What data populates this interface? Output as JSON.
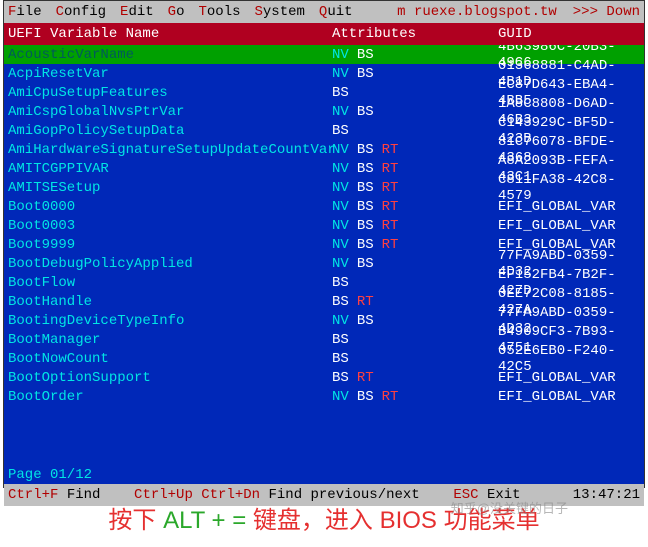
{
  "menubar": {
    "items": [
      {
        "hotkey": "F",
        "rest": "ile"
      },
      {
        "hotkey": "C",
        "rest": "onfig"
      },
      {
        "hotkey": "E",
        "rest": "dit"
      },
      {
        "hotkey": "G",
        "rest": "o"
      },
      {
        "hotkey": "T",
        "rest": "ools"
      },
      {
        "hotkey": "S",
        "rest": "ystem"
      },
      {
        "hotkey": "Q",
        "rest": "uit"
      }
    ],
    "right1": "m ruexe.blogspot.tw",
    "right2": ">>> Down"
  },
  "header": {
    "col1": "UEFI Variable Name",
    "col2": "Attributes",
    "col3": "GUID"
  },
  "rows": [
    {
      "name": "AcousticVarName",
      "attrs": [
        "NV",
        "BS"
      ],
      "guid": "4B63986C-20B3-49C6",
      "selected": true
    },
    {
      "name": "AcpiResetVar",
      "attrs": [
        "NV",
        "BS"
      ],
      "guid": "01368881-C4AD-4B1D"
    },
    {
      "name": "AmiCpuSetupFeatures",
      "attrs": [
        "BS"
      ],
      "guid": "EC87D643-EBA4-4BB5"
    },
    {
      "name": "AmiCspGlobalNvsPtrVar",
      "attrs": [
        "NV",
        "BS"
      ],
      "guid": "1A8C8808-D6AD-46B3"
    },
    {
      "name": "AmiGopPolicySetupData",
      "attrs": [
        "BS"
      ],
      "guid": "C143929C-BF5D-423B"
    },
    {
      "name": "AmiHardwareSignatureSetupUpdateCountVar",
      "attrs": [
        "NV",
        "BS",
        "RT"
      ],
      "guid": "81C76078-BFDE-4368"
    },
    {
      "name": "AMITCGPPIVAR",
      "attrs": [
        "NV",
        "BS",
        "RT"
      ],
      "guid": "A8A2093B-FEFA-43C1"
    },
    {
      "name": "AMITSESetup",
      "attrs": [
        "NV",
        "BS",
        "RT"
      ],
      "guid": "C811FA38-42C8-4579"
    },
    {
      "name": "Boot0000",
      "attrs": [
        "NV",
        "BS",
        "RT"
      ],
      "guid": "EFI_GLOBAL_VAR"
    },
    {
      "name": "Boot0003",
      "attrs": [
        "NV",
        "BS",
        "RT"
      ],
      "guid": "EFI_GLOBAL_VAR"
    },
    {
      "name": "Boot9999",
      "attrs": [
        "NV",
        "BS",
        "RT"
      ],
      "guid": "EFI_GLOBAL_VAR"
    },
    {
      "name": "BootDebugPolicyApplied",
      "attrs": [
        "NV",
        "BS"
      ],
      "guid": "77FA9ABD-0359-4D32"
    },
    {
      "name": "BootFlow",
      "attrs": [
        "BS"
      ],
      "guid": "EF152FB4-7B2F-427D"
    },
    {
      "name": "BootHandle",
      "attrs": [
        "BS",
        "RT"
      ],
      "guid": "0EE72C08-8185-427A"
    },
    {
      "name": "BootingDeviceTypeInfo",
      "attrs": [
        "NV",
        "BS"
      ],
      "guid": "77FA9ABD-0359-4D32"
    },
    {
      "name": "BootManager",
      "attrs": [
        "BS"
      ],
      "guid": "B4909CF3-7B93-4751"
    },
    {
      "name": "BootNowCount",
      "attrs": [
        "BS"
      ],
      "guid": "052E6EB0-F240-42C5"
    },
    {
      "name": "BootOptionSupport",
      "attrs": [
        "BS",
        "RT"
      ],
      "guid": "EFI_GLOBAL_VAR"
    },
    {
      "name": "BootOrder",
      "attrs": [
        "NV",
        "BS",
        "RT"
      ],
      "guid": "EFI_GLOBAL_VAR"
    }
  ],
  "pager": "Page 01/12",
  "footer": {
    "left_key1": "Ctrl+F",
    "left_txt1": "Find",
    "left_key2": "Ctrl+Up Ctrl+Dn",
    "left_txt2": "Find previous/next",
    "left_key3": "ESC",
    "left_txt3": "Exit",
    "time": "13:47:21"
  },
  "caption": {
    "p1": "按下 ",
    "alt": "ALT + = ",
    "p2": " 键盘，进入",
    "bios": "BIOS",
    "p3": "功能菜单"
  },
  "watermark": "知乎@没关键的日子"
}
